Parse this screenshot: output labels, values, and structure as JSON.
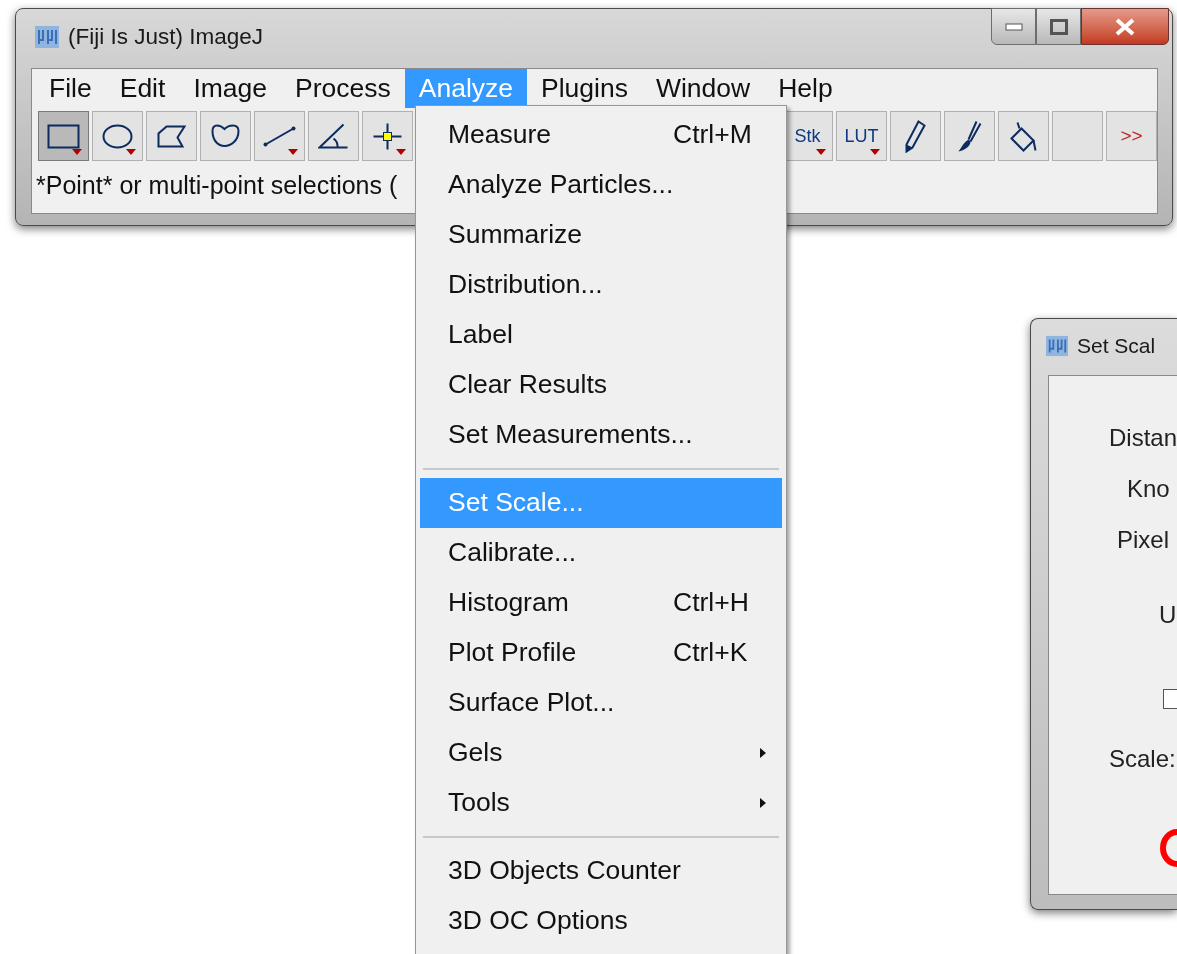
{
  "window": {
    "title": "(Fiji Is Just) ImageJ"
  },
  "menu_bar": [
    {
      "label": "File",
      "selected": false
    },
    {
      "label": "Edit",
      "selected": false
    },
    {
      "label": "Image",
      "selected": false
    },
    {
      "label": "Process",
      "selected": false
    },
    {
      "label": "Analyze",
      "selected": true
    },
    {
      "label": "Plugins",
      "selected": false
    },
    {
      "label": "Window",
      "selected": false
    },
    {
      "label": "Help",
      "selected": false
    }
  ],
  "toolbar": {
    "left": [
      {
        "kind": "rectangle",
        "selected": true,
        "dropdown": true
      },
      {
        "kind": "oval",
        "selected": false,
        "dropdown": true
      },
      {
        "kind": "polygon",
        "selected": false,
        "dropdown": false
      },
      {
        "kind": "freehand",
        "selected": false,
        "dropdown": false
      },
      {
        "kind": "line",
        "selected": false,
        "dropdown": true
      },
      {
        "kind": "angle",
        "selected": false,
        "dropdown": false
      },
      {
        "kind": "point",
        "selected": false,
        "dropdown": true
      }
    ],
    "right": [
      {
        "kind": "text",
        "label": "Stk",
        "selected": false,
        "dropdown": true
      },
      {
        "kind": "text",
        "label": "LUT",
        "selected": false,
        "dropdown": true
      },
      {
        "kind": "pencil",
        "selected": false,
        "dropdown": false
      },
      {
        "kind": "brush",
        "selected": false,
        "dropdown": false
      },
      {
        "kind": "fill",
        "selected": false,
        "dropdown": false
      },
      {
        "kind": "empty",
        "selected": false,
        "dropdown": false
      },
      {
        "kind": "text",
        "label": ">>",
        "selected": false,
        "dropdown": false
      }
    ]
  },
  "status_bar": "*Point* or multi-point selections (",
  "analyze_menu": [
    {
      "kind": "item",
      "label": "Measure",
      "shortcut": "Ctrl+M",
      "selected": false
    },
    {
      "kind": "item",
      "label": "Analyze Particles...",
      "selected": false
    },
    {
      "kind": "item",
      "label": "Summarize",
      "selected": false
    },
    {
      "kind": "item",
      "label": "Distribution...",
      "selected": false
    },
    {
      "kind": "item",
      "label": "Label",
      "selected": false
    },
    {
      "kind": "item",
      "label": "Clear Results",
      "selected": false
    },
    {
      "kind": "item",
      "label": "Set Measurements...",
      "selected": false
    },
    {
      "kind": "separator"
    },
    {
      "kind": "item",
      "label": "Set Scale...",
      "selected": true
    },
    {
      "kind": "item",
      "label": "Calibrate...",
      "selected": false
    },
    {
      "kind": "item",
      "label": "Histogram",
      "shortcut": "Ctrl+H",
      "selected": false
    },
    {
      "kind": "item",
      "label": "Plot Profile",
      "shortcut": "Ctrl+K",
      "selected": false
    },
    {
      "kind": "item",
      "label": "Surface Plot...",
      "selected": false
    },
    {
      "kind": "item",
      "label": "Gels",
      "submenu": true,
      "selected": false
    },
    {
      "kind": "item",
      "label": "Tools",
      "submenu": true,
      "selected": false
    },
    {
      "kind": "separator"
    },
    {
      "kind": "item",
      "label": "3D Objects Counter",
      "selected": false
    },
    {
      "kind": "item",
      "label": "3D OC Options",
      "selected": false
    }
  ],
  "dialog": {
    "title": "Set Scal",
    "rows": [
      {
        "kind": "label",
        "label": "Distan"
      },
      {
        "kind": "label",
        "label": "Kno"
      },
      {
        "kind": "label",
        "label": "Pixel"
      },
      {
        "kind": "label",
        "label": "U"
      },
      {
        "kind": "checkbox",
        "checked": false
      },
      {
        "kind": "label",
        "label": "Scale:"
      }
    ]
  }
}
